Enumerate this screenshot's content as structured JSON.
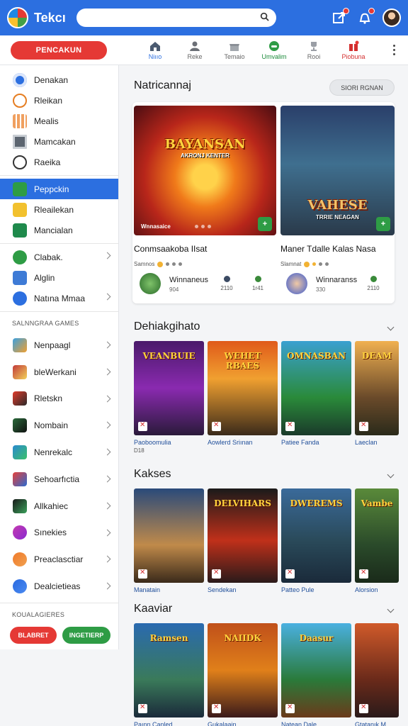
{
  "app": {
    "title": "Tekcı"
  },
  "search": {
    "placeholder": "",
    "value": ""
  },
  "subbar": {
    "primary_button": "PENCAKUN",
    "tabs": [
      {
        "label": "Niııo",
        "icon": "home-icon"
      },
      {
        "label": "Reke",
        "icon": "people-icon"
      },
      {
        "label": "Temaio",
        "icon": "store-icon"
      },
      {
        "label": "Umvalim",
        "icon": "controller-icon"
      },
      {
        "label": "Rooi",
        "icon": "trophy-icon"
      },
      {
        "label": "Piobuna",
        "icon": "gift-icon"
      }
    ]
  },
  "sidebar": {
    "items": [
      {
        "label": "Denakan",
        "icon": "refresh-icon"
      },
      {
        "label": "Rleikan",
        "icon": "clock-icon"
      },
      {
        "label": "Mealis",
        "icon": "calendar-icon"
      },
      {
        "label": "Mamcakan",
        "icon": "mail-icon"
      },
      {
        "label": "Raeika",
        "icon": "compass-icon"
      },
      {
        "label": "Peppckin",
        "icon": "puzzle-icon"
      },
      {
        "label": "Rleailekan",
        "icon": "star-burst-icon"
      },
      {
        "label": "Mancialan",
        "icon": "leaf-icon"
      }
    ],
    "group2": [
      {
        "label": "Clabak."
      },
      {
        "label": "Alglin"
      },
      {
        "label": "Natına Mmaa"
      }
    ],
    "section_games": "SALNNGRAA GAMES",
    "games": [
      {
        "label": "Nenpaagl"
      },
      {
        "label": "bleWerkani"
      },
      {
        "label": "Rletskn"
      },
      {
        "label": "Nombain"
      },
      {
        "label": "Nenrekalc"
      },
      {
        "label": "Sehoarfıctia"
      },
      {
        "label": "Allkahiec"
      },
      {
        "label": "Sınekies"
      },
      {
        "label": "Preaclasctiar"
      },
      {
        "label": "Dealcietieas"
      }
    ],
    "section_bottom": "KOUALAGIERES",
    "btn_red": "BLABRET",
    "btn_green": "INGETIERP"
  },
  "main": {
    "featured_title": "Natricannaj",
    "featured_button": "SIORI RGNAN",
    "featured": [
      {
        "art_title": "BAYANSAN",
        "art_sub": "AKRONJ KENTER",
        "caption": "Wnnasaice",
        "name": "Conmsaakoba IIsat",
        "meta": "Samnos",
        "foot_name": "Winnaneus",
        "foot_small": "904",
        "stat1": "2110",
        "stat2": "1r41"
      },
      {
        "art_title": "VAHESE",
        "art_sub": "TRRIE NEAGAN",
        "caption": "",
        "name": "Maner Tdalle Kalas Nasa",
        "meta": "Slamnat",
        "foot_name": "Winnaranss",
        "foot_small": "330",
        "stat1": "2110",
        "stat2": ""
      }
    ],
    "rows": [
      {
        "title": "Dehiakgihato",
        "tiles": [
          {
            "art": "VEANBUIE",
            "name": "Paoboomulia",
            "sub": "D18"
          },
          {
            "art": "WEHET RBAES",
            "name": "Aowlerd Sriınan",
            "sub": ""
          },
          {
            "art": "OMNASBAN",
            "name": "Patiee Fanda",
            "sub": ""
          },
          {
            "art": "DEAM",
            "name": "Laeclan",
            "sub": ""
          }
        ]
      },
      {
        "title": "Kakses",
        "tiles": [
          {
            "art": "",
            "name": "Manatain",
            "sub": ""
          },
          {
            "art": "DELVIHARS",
            "name": "Sendekan",
            "sub": ""
          },
          {
            "art": "DWEREMS",
            "name": "Patteo Pule",
            "sub": ""
          },
          {
            "art": "Vambe",
            "name": "Alorsion",
            "sub": ""
          }
        ]
      },
      {
        "title": "Kaaviar",
        "tiles": [
          {
            "art": "Ramsen",
            "name": "Paınn Canled",
            "sub": ""
          },
          {
            "art": "NAIIDK",
            "name": "Gukalaain",
            "sub": ""
          },
          {
            "art": "Daasur",
            "name": "Natean Dale",
            "sub": ""
          },
          {
            "art": "",
            "name": "Gtatanık M",
            "sub": ""
          }
        ]
      }
    ]
  },
  "colors": {
    "brand_blue": "#2c6fe0",
    "accent_red": "#e53935",
    "accent_green": "#2e9c45"
  }
}
